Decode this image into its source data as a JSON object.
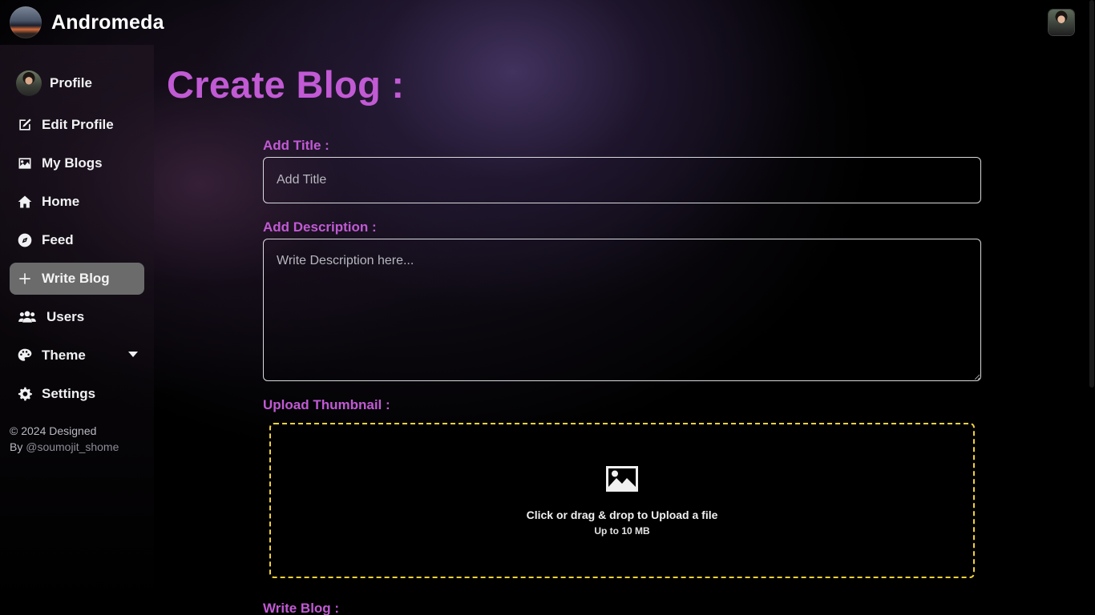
{
  "app": {
    "name": "Andromeda"
  },
  "sidebar": {
    "items": [
      {
        "label": "Profile",
        "icon": "avatar"
      },
      {
        "label": "Edit Profile",
        "icon": "edit-icon"
      },
      {
        "label": "My Blogs",
        "icon": "image-icon"
      },
      {
        "label": "Home",
        "icon": "home-icon"
      },
      {
        "label": "Feed",
        "icon": "compass-icon"
      },
      {
        "label": "Write Blog",
        "icon": "plus-icon",
        "active": true
      },
      {
        "label": "Users",
        "icon": "users-icon"
      },
      {
        "label": "Theme",
        "icon": "palette-icon"
      },
      {
        "label": "Settings",
        "icon": "gear-icon"
      }
    ],
    "footer": {
      "line1": "© 2024 Designed",
      "by": "By ",
      "handle": "@soumojit_shome"
    }
  },
  "main": {
    "title": "Create Blog :",
    "title_label": "Add Title :",
    "title_placeholder": "Add Title",
    "description_label": "Add Description :",
    "description_placeholder": "Write Description here...",
    "thumbnail_label": "Upload Thumbnail :",
    "dropzone_text": "Click or drag & drop to Upload a file",
    "dropzone_subtext": "Up to 10 MB",
    "write_label": "Write Blog :"
  },
  "colors": {
    "accent": "#c15ad4",
    "dropzone_border": "#f2d23a",
    "active_item": "#6b6b6b"
  }
}
